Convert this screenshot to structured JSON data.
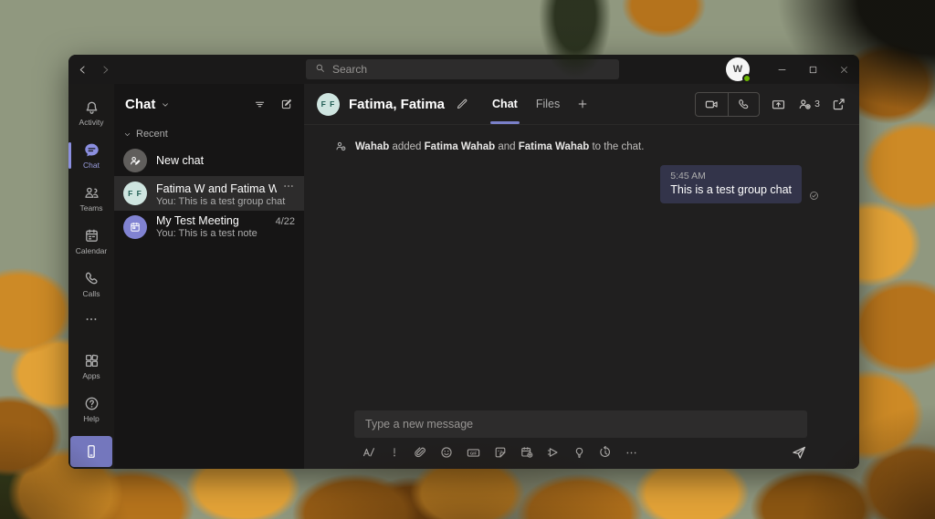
{
  "titlebar": {
    "search_placeholder": "Search",
    "user_initial": "W"
  },
  "rail": {
    "items": [
      {
        "label": "Activity"
      },
      {
        "label": "Chat"
      },
      {
        "label": "Teams"
      },
      {
        "label": "Calendar"
      },
      {
        "label": "Calls"
      }
    ],
    "bottom_items": [
      {
        "label": "Apps"
      },
      {
        "label": "Help"
      }
    ]
  },
  "chatlist": {
    "title": "Chat",
    "section_label": "Recent",
    "new_chat": {
      "title": "New chat"
    },
    "group_chat": {
      "avatar": "F F",
      "title": "Fatima W and Fatima W",
      "subtitle": "You: This is a test group chat"
    },
    "meeting_chat": {
      "title": "My Test Meeting",
      "subtitle": "You: This is a test note",
      "date": "4/22"
    }
  },
  "chat": {
    "header": {
      "avatar": "F F",
      "title": "Fatima, Fatima",
      "tab_chat": "Chat",
      "tab_files": "Files",
      "participant_count": "3"
    },
    "system_message": {
      "actor": "Wahab",
      "t1": " added ",
      "name1": "Fatima Wahab",
      "t2": " and ",
      "name2": "Fatima Wahab",
      "t3": " to the chat."
    },
    "message": {
      "time": "5:45 AM",
      "text": "This is a test group chat"
    },
    "compose_placeholder": "Type a new message"
  },
  "colors": {
    "accent_lavender": "#7a80c9",
    "mobile_button": "#7477bd",
    "presence_green": "#6bb700",
    "bubble": "#33344a",
    "avatar_teal_bg": "#cfe5e0",
    "avatar_teal_text": "#1f5c52",
    "panel_dark": "#161515",
    "panel_main": "#201f1f"
  }
}
